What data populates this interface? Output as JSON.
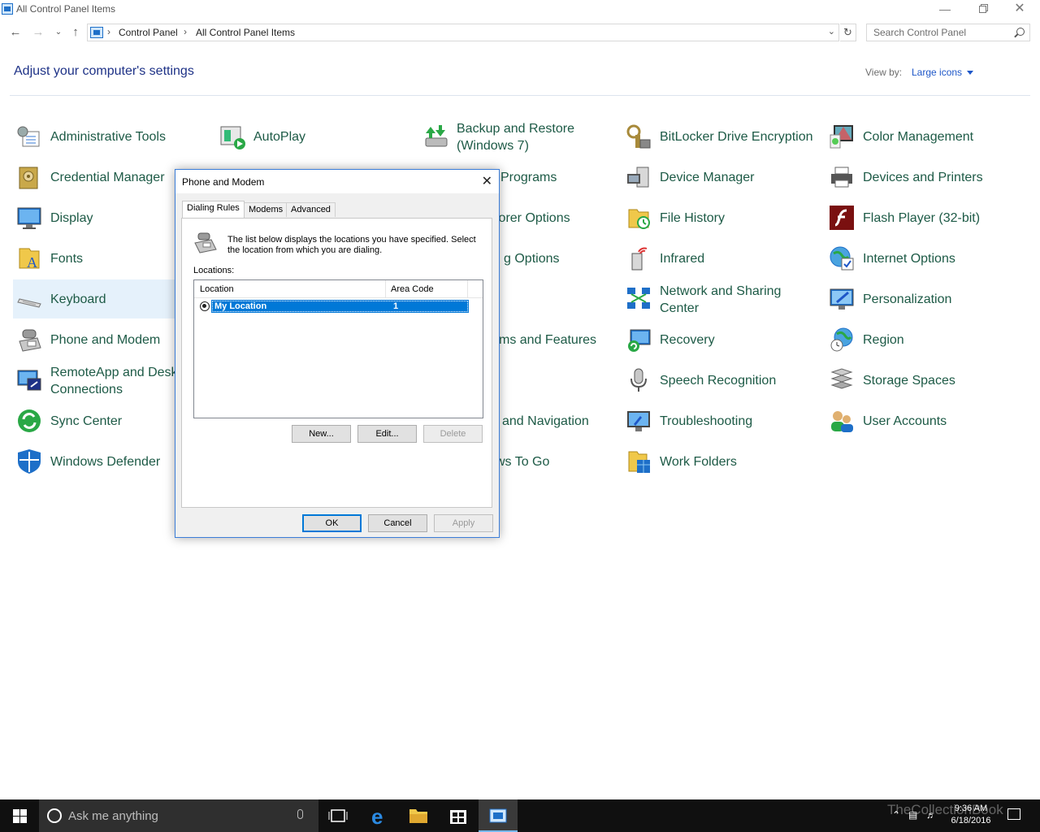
{
  "window": {
    "title": "All Control Panel Items"
  },
  "address": {
    "crumbs": [
      "Control Panel",
      "All Control Panel Items"
    ],
    "search_placeholder": "Search Control Panel"
  },
  "header": {
    "heading": "Adjust your computer's settings",
    "view_by_label": "View by:",
    "view_by_value": "Large icons"
  },
  "items": [
    {
      "label": "Administrative Tools",
      "icon": "admin-tools-icon"
    },
    {
      "label": "AutoPlay",
      "icon": "autoplay-icon"
    },
    {
      "label": "Backup and Restore (Windows 7)",
      "icon": "backup-icon"
    },
    {
      "label": "BitLocker Drive Encryption",
      "icon": "bitlocker-icon"
    },
    {
      "label": "Color Management",
      "icon": "color-management-icon"
    },
    {
      "label": "Credential Manager",
      "icon": "credential-manager-icon"
    },
    {
      "label": "Programs",
      "icon": "programs-icon"
    },
    {
      "label": "Device Manager",
      "icon": "device-manager-icon"
    },
    {
      "label": "Devices and Printers",
      "icon": "printer-icon"
    },
    {
      "label": "Display",
      "icon": "display-icon"
    },
    {
      "label": "lorer Options",
      "icon": "folder-options-icon"
    },
    {
      "label": "File History",
      "icon": "file-history-icon"
    },
    {
      "label": "Flash Player (32-bit)",
      "icon": "flash-icon"
    },
    {
      "label": "Fonts",
      "icon": "fonts-icon"
    },
    {
      "label": "g Options",
      "icon": "options-icon"
    },
    {
      "label": "Infrared",
      "icon": "infrared-icon"
    },
    {
      "label": "Internet Options",
      "icon": "internet-options-icon"
    },
    {
      "label": "Keyboard",
      "icon": "keyboard-icon"
    },
    {
      "label": "Network and Sharing Center",
      "icon": "network-icon"
    },
    {
      "label": "Personalization",
      "icon": "personalization-icon"
    },
    {
      "label": "Phone and Modem",
      "icon": "phone-icon"
    },
    {
      "label": "ms and Features",
      "icon": "features-icon"
    },
    {
      "label": "Recovery",
      "icon": "recovery-icon"
    },
    {
      "label": "Region",
      "icon": "region-icon"
    },
    {
      "label": "RemoteApp and Desktop Connections",
      "icon": "remoteapp-icon"
    },
    {
      "label": "Speech Recognition",
      "icon": "microphone-icon"
    },
    {
      "label": "Storage Spaces",
      "icon": "storage-icon"
    },
    {
      "label": "Sync Center",
      "icon": "sync-icon"
    },
    {
      "label": "and Navigation",
      "icon": "navigation-icon"
    },
    {
      "label": "Troubleshooting",
      "icon": "troubleshooting-icon"
    },
    {
      "label": "User Accounts",
      "icon": "users-icon"
    },
    {
      "label": "Windows Defender",
      "icon": "shield-icon"
    },
    {
      "label": "ws To Go",
      "icon": "windows-to-go-icon"
    },
    {
      "label": "Work Folders",
      "icon": "work-folders-icon"
    }
  ],
  "dialog": {
    "title": "Phone and Modem",
    "tabs": [
      "Dialing Rules",
      "Modems",
      "Advanced"
    ],
    "description": "The list below displays the locations you have specified. Select the location from which you are dialing.",
    "locations_label": "Locations:",
    "columns": [
      "Location",
      "Area Code"
    ],
    "rows": [
      {
        "location": "My Location",
        "area_code": "1"
      }
    ],
    "buttons": {
      "new": "New...",
      "edit": "Edit...",
      "delete": "Delete",
      "ok": "OK",
      "cancel": "Cancel",
      "apply": "Apply"
    }
  },
  "taskbar": {
    "search_placeholder": "Ask me anything",
    "time": "9:36 AM",
    "date": "6/18/2016",
    "watermark": "TheCollectionBook"
  },
  "colors": {
    "accent": "#0078d7",
    "item_text": "#1d5a46",
    "heading": "#1e3287",
    "taskbar": "#101010"
  }
}
